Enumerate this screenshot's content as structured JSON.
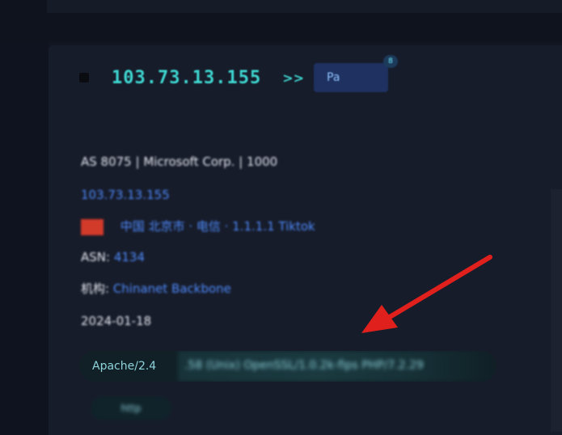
{
  "host": {
    "ip_address": "103.73.13.155",
    "tag": {
      "label": "Pa",
      "count": "8"
    }
  },
  "details": {
    "org_line": "AS 8075 | Microsoft Corp. | 1000",
    "hostname_line": "103.73.13.155",
    "location": {
      "label": "中国 北京市",
      "extra": "· 电信 · 1.1.1.1 Tiktok"
    },
    "asn_row": {
      "key": "ASN: ",
      "value": "4134"
    },
    "org_row": {
      "key": "机构: ",
      "value": "Chinanet Backbone"
    },
    "date_line": "2024-01-18"
  },
  "service": {
    "banner_visible": "Apache/2.4",
    "banner_hidden": ".58 (Unix) OpenSSL/1.0.2k-fips PHP/7.2.29",
    "chip_label": "http"
  },
  "annotation": {
    "arrow_color": "#e0201c"
  }
}
